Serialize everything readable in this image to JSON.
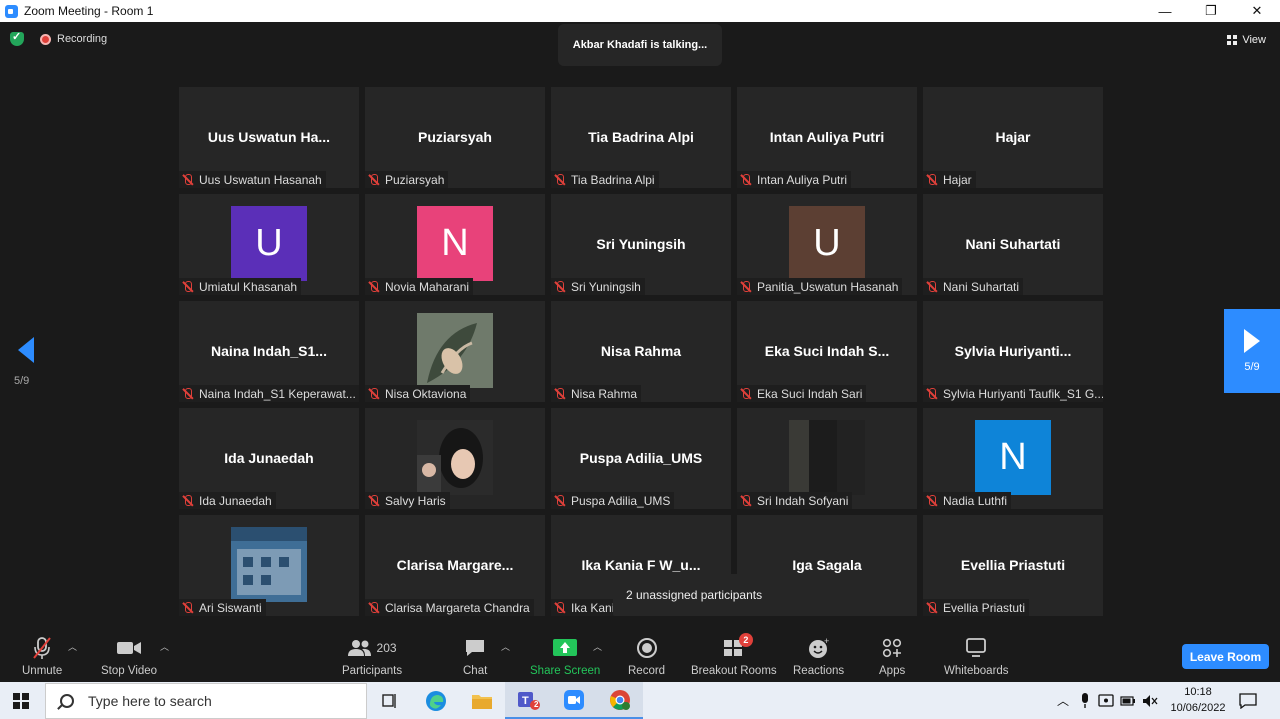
{
  "window": {
    "title": "Zoom Meeting - Room 1",
    "minimize": "—",
    "maximize": "❐",
    "close": "✕"
  },
  "top": {
    "recording": "Recording",
    "talking": "Akbar Khadafi is talking...",
    "view": "View"
  },
  "pagination": {
    "left": "5/9",
    "right": "5/9"
  },
  "tiles": [
    {
      "big": "Uus  Uswatun  Ha...",
      "tag": "Uus Uswatun Hasanah",
      "kind": "name"
    },
    {
      "big": "Puziarsyah",
      "tag": "Puziarsyah",
      "kind": "name"
    },
    {
      "big": "Tia Badrina Alpi",
      "tag": "Tia Badrina Alpi",
      "kind": "name"
    },
    {
      "big": "Intan Auliya Putri",
      "tag": "Intan Auliya Putri",
      "kind": "name"
    },
    {
      "big": "Hajar",
      "tag": "Hajar",
      "kind": "name"
    },
    {
      "big": "U",
      "tag": "Umiatul Khasanah",
      "kind": "avatar",
      "color": "#5b2fb8"
    },
    {
      "big": "N",
      "tag": "Novia Maharani",
      "kind": "avatar",
      "color": "#e8427a"
    },
    {
      "big": "Sri Yuningsih",
      "tag": "Sri Yuningsih",
      "kind": "name"
    },
    {
      "big": "U",
      "tag": "Panitia_Uswatun Hasanah",
      "kind": "avatar",
      "color": "#5c3f33"
    },
    {
      "big": "Nani Suhartati",
      "tag": "Nani Suhartati",
      "kind": "name"
    },
    {
      "big": "Naina  Indah_S1...",
      "tag": "Naina Indah_S1 Keperawat...",
      "kind": "name"
    },
    {
      "big": "",
      "tag": "Nisa Oktaviona",
      "kind": "photo",
      "photo": "leaf"
    },
    {
      "big": "Nisa Rahma",
      "tag": "Nisa Rahma",
      "kind": "name"
    },
    {
      "big": "Eka  Suci  Indah  S...",
      "tag": "Eka Suci Indah Sari",
      "kind": "name"
    },
    {
      "big": "Sylvia  Huriyanti...",
      "tag": "Sylvia Huriyanti Taufik_S1 G...",
      "kind": "name"
    },
    {
      "big": "Ida Junaedah",
      "tag": "Ida Junaedah",
      "kind": "name"
    },
    {
      "big": "",
      "tag": "Salvy Haris",
      "kind": "photo",
      "photo": "selfie"
    },
    {
      "big": "Puspa Adilia_UMS",
      "tag": "Puspa Adilia_UMS",
      "kind": "name"
    },
    {
      "big": "",
      "tag": "Sri Indah Sofyani",
      "kind": "photo",
      "photo": "dark"
    },
    {
      "big": "N",
      "tag": "Nadia Luthfi",
      "kind": "avatar",
      "color": "#0e84d8"
    },
    {
      "big": "",
      "tag": "Ari Siswanti",
      "kind": "photo",
      "photo": "building"
    },
    {
      "big": "Clarisa  Margare...",
      "tag": "Clarisa Margareta Chandra",
      "kind": "name"
    },
    {
      "big": "Ika  Kania  F  W_u...",
      "tag": "Ika Kani",
      "kind": "name"
    },
    {
      "big": "Iga Sagala",
      "tag": "",
      "kind": "name"
    },
    {
      "big": "Evellia Priastuti",
      "tag": "Evellia Priastuti",
      "kind": "name"
    }
  ],
  "tooltip": "2 unassigned participants",
  "toolbar": {
    "unmute": "Unmute",
    "stop_video": "Stop Video",
    "participants": "Participants",
    "participants_count": "203",
    "chat": "Chat",
    "share": "Share Screen",
    "record": "Record",
    "breakout": "Breakout Rooms",
    "breakout_badge": "2",
    "reactions": "Reactions",
    "apps": "Apps",
    "whiteboards": "Whiteboards",
    "leave": "Leave Room"
  },
  "taskbar": {
    "search_placeholder": "Type here to search",
    "time": "10:18",
    "date": "10/06/2022",
    "teams_badge": "2"
  },
  "colors": {
    "accent": "#2D8CFF",
    "share": "#23c55a",
    "muted": "#e0403a"
  }
}
